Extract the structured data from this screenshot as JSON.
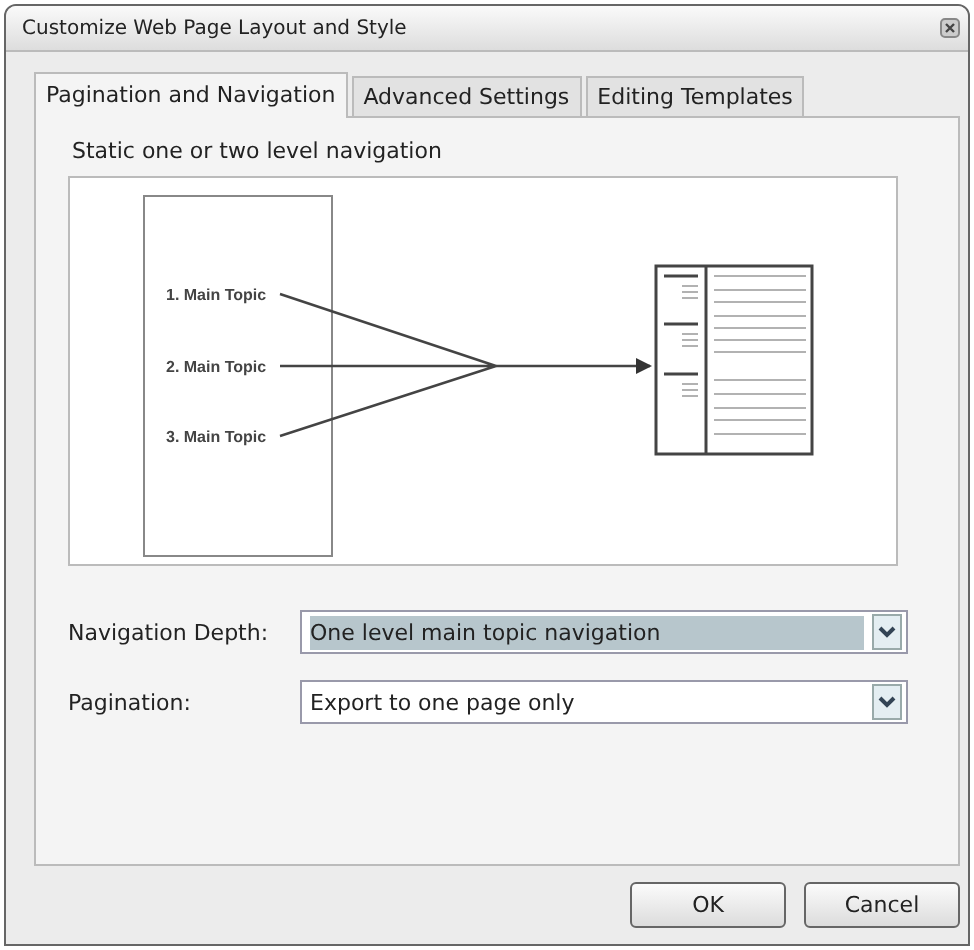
{
  "window": {
    "title": "Customize Web Page Layout and Style"
  },
  "tabs": [
    {
      "label": "Pagination and Navigation",
      "selected": true
    },
    {
      "label": "Advanced Settings",
      "selected": false
    },
    {
      "label": "Editing Templates",
      "selected": false
    }
  ],
  "section_label": "Static one or two level navigation",
  "diagram": {
    "topics": [
      "1. Main Topic",
      "2. Main Topic",
      "3. Main Topic"
    ]
  },
  "fields": [
    {
      "label": "Navigation Depth:",
      "value": "One level main topic navigation",
      "focused": true
    },
    {
      "label": "Pagination:",
      "value": "Export to one page only",
      "focused": false
    }
  ],
  "buttons": [
    "OK",
    "Cancel"
  ]
}
